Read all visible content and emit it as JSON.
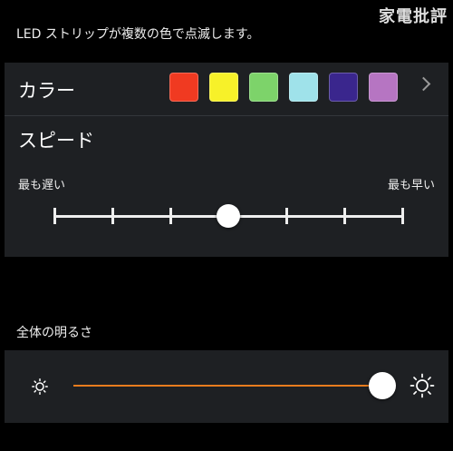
{
  "watermark": "家電批評",
  "description": "LED ストリップが複数の色で点滅します。",
  "color_row": {
    "label": "カラー",
    "swatches": [
      {
        "name": "red",
        "color": "#f03a21"
      },
      {
        "name": "yellow",
        "color": "#f7f129"
      },
      {
        "name": "green",
        "color": "#7dd36a"
      },
      {
        "name": "light-blue",
        "color": "#9fe2ea"
      },
      {
        "name": "indigo",
        "color": "#3a268d"
      },
      {
        "name": "violet",
        "color": "#b675c2"
      }
    ],
    "more_icon": "chevron-right-icon"
  },
  "speed": {
    "label": "スピード",
    "min_label": "最も遅い",
    "max_label": "最も早い",
    "steps": 7,
    "value_index": 3
  },
  "brightness": {
    "heading": "全体の明るさ",
    "min_icon": "sun-small-icon",
    "max_icon": "sun-large-icon",
    "value_fraction": 1.0,
    "accent_color": "#e87c1e"
  }
}
